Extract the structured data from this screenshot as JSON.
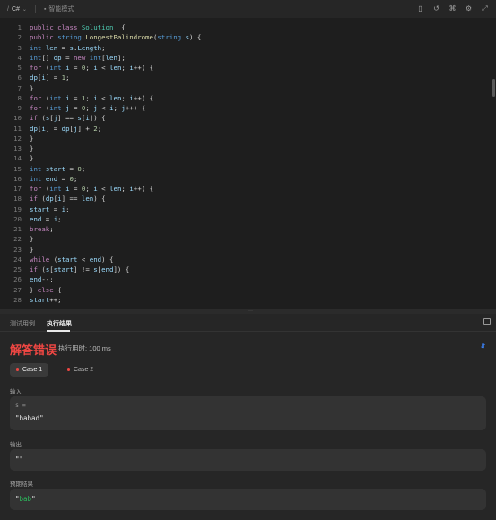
{
  "toolbar": {
    "language": "C#",
    "mode": "智能模式",
    "tools": [
      "bookmark-icon",
      "reset-icon",
      "shortcut-icon",
      "settings-icon",
      "expand-icon"
    ]
  },
  "editor": {
    "lines": [
      {
        "n": "1",
        "t": [
          [
            "kw",
            "public "
          ],
          [
            "kw",
            "class "
          ],
          [
            "cls",
            "Solution"
          ],
          [
            "",
            "  {"
          ]
        ]
      },
      {
        "n": "2",
        "t": [
          [
            "kw",
            "public "
          ],
          [
            "ty",
            "string "
          ],
          [
            "fn",
            "LongestPalindrome"
          ],
          [
            "",
            "("
          ],
          [
            "ty",
            "string "
          ],
          [
            "id",
            "s"
          ],
          [
            "",
            ") {"
          ]
        ]
      },
      {
        "n": "3",
        "t": [
          [
            "ty",
            "int "
          ],
          [
            "id",
            "len"
          ],
          [
            "",
            " = "
          ],
          [
            "id",
            "s"
          ],
          [
            "",
            "."
          ],
          [
            "id",
            "Length"
          ],
          [
            "",
            ";"
          ]
        ]
      },
      {
        "n": "4",
        "t": [
          [
            "ty",
            "int"
          ],
          [
            "",
            "[] "
          ],
          [
            "id",
            "dp"
          ],
          [
            "",
            " = "
          ],
          [
            "kw",
            "new "
          ],
          [
            "ty",
            "int"
          ],
          [
            "",
            "["
          ],
          [
            "id",
            "len"
          ],
          [
            "",
            "];"
          ]
        ]
      },
      {
        "n": "5",
        "t": [
          [
            "kw",
            "for "
          ],
          [
            "",
            "("
          ],
          [
            "ty",
            "int "
          ],
          [
            "id",
            "i"
          ],
          [
            "",
            " = "
          ],
          [
            "num",
            "0"
          ],
          [
            "",
            "; "
          ],
          [
            "id",
            "i"
          ],
          [
            "",
            " < "
          ],
          [
            "id",
            "len"
          ],
          [
            "",
            "; "
          ],
          [
            "id",
            "i"
          ],
          [
            "",
            "++) {"
          ]
        ]
      },
      {
        "n": "6",
        "t": [
          [
            "id",
            "dp"
          ],
          [
            "",
            "["
          ],
          [
            "id",
            "i"
          ],
          [
            "",
            "] = "
          ],
          [
            "num",
            "1"
          ],
          [
            "",
            ";"
          ]
        ]
      },
      {
        "n": "7",
        "t": [
          [
            "",
            "}"
          ]
        ]
      },
      {
        "n": "8",
        "t": [
          [
            "kw",
            "for "
          ],
          [
            "",
            "("
          ],
          [
            "ty",
            "int "
          ],
          [
            "id",
            "i"
          ],
          [
            "",
            " = "
          ],
          [
            "num",
            "1"
          ],
          [
            "",
            "; "
          ],
          [
            "id",
            "i"
          ],
          [
            "",
            " < "
          ],
          [
            "id",
            "len"
          ],
          [
            "",
            "; "
          ],
          [
            "id",
            "i"
          ],
          [
            "",
            "++) {"
          ]
        ]
      },
      {
        "n": "9",
        "t": [
          [
            "kw",
            "for "
          ],
          [
            "",
            "("
          ],
          [
            "ty",
            "int "
          ],
          [
            "id",
            "j"
          ],
          [
            "",
            " = "
          ],
          [
            "num",
            "0"
          ],
          [
            "",
            "; "
          ],
          [
            "id",
            "j"
          ],
          [
            "",
            " < "
          ],
          [
            "id",
            "i"
          ],
          [
            "",
            "; "
          ],
          [
            "id",
            "j"
          ],
          [
            "",
            "++) {"
          ]
        ]
      },
      {
        "n": "10",
        "t": [
          [
            "kw",
            "if "
          ],
          [
            "",
            "("
          ],
          [
            "id",
            "s"
          ],
          [
            "",
            "["
          ],
          [
            "id",
            "j"
          ],
          [
            "",
            "] == "
          ],
          [
            "id",
            "s"
          ],
          [
            "",
            "["
          ],
          [
            "id",
            "i"
          ],
          [
            "",
            "]) {"
          ]
        ]
      },
      {
        "n": "11",
        "t": [
          [
            "id",
            "dp"
          ],
          [
            "",
            "["
          ],
          [
            "id",
            "i"
          ],
          [
            "",
            "] = "
          ],
          [
            "id",
            "dp"
          ],
          [
            "",
            "["
          ],
          [
            "id",
            "j"
          ],
          [
            "",
            "] + "
          ],
          [
            "num",
            "2"
          ],
          [
            "",
            ";"
          ]
        ]
      },
      {
        "n": "12",
        "t": [
          [
            "",
            "}"
          ]
        ]
      },
      {
        "n": "13",
        "t": [
          [
            "",
            "}"
          ]
        ]
      },
      {
        "n": "14",
        "t": [
          [
            "",
            "}"
          ]
        ]
      },
      {
        "n": "15",
        "t": [
          [
            "ty",
            "int "
          ],
          [
            "id",
            "start"
          ],
          [
            "",
            " = "
          ],
          [
            "num",
            "0"
          ],
          [
            "",
            ";"
          ]
        ]
      },
      {
        "n": "16",
        "t": [
          [
            "ty",
            "int "
          ],
          [
            "id",
            "end"
          ],
          [
            "",
            " = "
          ],
          [
            "num",
            "0"
          ],
          [
            "",
            ";"
          ]
        ]
      },
      {
        "n": "17",
        "t": [
          [
            "kw",
            "for "
          ],
          [
            "",
            "("
          ],
          [
            "ty",
            "int "
          ],
          [
            "id",
            "i"
          ],
          [
            "",
            " = "
          ],
          [
            "num",
            "0"
          ],
          [
            "",
            "; "
          ],
          [
            "id",
            "i"
          ],
          [
            "",
            " < "
          ],
          [
            "id",
            "len"
          ],
          [
            "",
            "; "
          ],
          [
            "id",
            "i"
          ],
          [
            "",
            "++) {"
          ]
        ]
      },
      {
        "n": "18",
        "t": [
          [
            "kw",
            "if "
          ],
          [
            "",
            "("
          ],
          [
            "id",
            "dp"
          ],
          [
            "",
            "["
          ],
          [
            "id",
            "i"
          ],
          [
            "",
            "] == "
          ],
          [
            "id",
            "len"
          ],
          [
            "",
            ") {"
          ]
        ]
      },
      {
        "n": "19",
        "t": [
          [
            "id",
            "start"
          ],
          [
            "",
            " = "
          ],
          [
            "id",
            "i"
          ],
          [
            "",
            ";"
          ]
        ]
      },
      {
        "n": "20",
        "t": [
          [
            "id",
            "end"
          ],
          [
            "",
            " = "
          ],
          [
            "id",
            "i"
          ],
          [
            "",
            ";"
          ]
        ]
      },
      {
        "n": "21",
        "t": [
          [
            "kw",
            "break"
          ],
          [
            "",
            ";"
          ]
        ]
      },
      {
        "n": "22",
        "t": [
          [
            "",
            "}"
          ]
        ]
      },
      {
        "n": "23",
        "t": [
          [
            "",
            "}"
          ]
        ]
      },
      {
        "n": "24",
        "t": [
          [
            "kw",
            "while "
          ],
          [
            "",
            "("
          ],
          [
            "id",
            "start"
          ],
          [
            "",
            " < "
          ],
          [
            "id",
            "end"
          ],
          [
            "",
            ") {"
          ]
        ]
      },
      {
        "n": "25",
        "t": [
          [
            "kw",
            "if "
          ],
          [
            "",
            "("
          ],
          [
            "id",
            "s"
          ],
          [
            "",
            "["
          ],
          [
            "id",
            "start"
          ],
          [
            "",
            "] != "
          ],
          [
            "id",
            "s"
          ],
          [
            "",
            "["
          ],
          [
            "id",
            "end"
          ],
          [
            "",
            "]) {"
          ]
        ]
      },
      {
        "n": "26",
        "t": [
          [
            "id",
            "end"
          ],
          [
            "",
            "--;"
          ]
        ]
      },
      {
        "n": "27",
        "t": [
          [
            "",
            "} "
          ],
          [
            "kw",
            "else "
          ],
          [
            "",
            "{"
          ]
        ]
      },
      {
        "n": "28",
        "t": [
          [
            "id",
            "start"
          ],
          [
            "",
            "++;"
          ]
        ]
      }
    ]
  },
  "panel": {
    "tabs": [
      {
        "label": "测试用例",
        "active": false
      },
      {
        "label": "执行结果",
        "active": true
      }
    ],
    "verdict": "解答错误",
    "runtime": "执行用时: 100 ms",
    "cases": [
      {
        "label": "Case 1",
        "active": true
      },
      {
        "label": "Case 2",
        "active": false
      }
    ],
    "input_label": "输入",
    "input_var": "s =",
    "input_value": "\"babad\"",
    "output_label": "输出",
    "output_value": "\"\"",
    "expected_label": "预期结果",
    "expected_quote_open": "\"",
    "expected_value": "bab",
    "expected_quote_close": "\""
  },
  "colors": {
    "error": "#ef4743",
    "accent_green": "#2cbb5d",
    "keyword": "#c586c0",
    "type": "#569cd6"
  }
}
